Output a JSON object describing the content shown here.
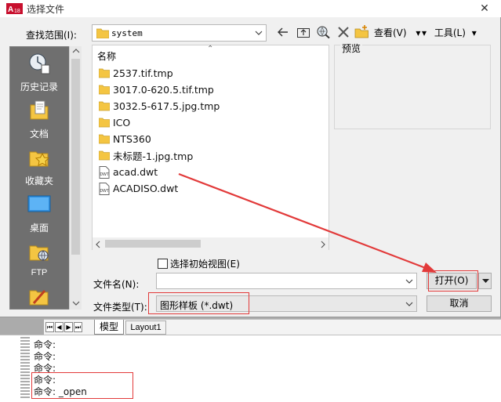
{
  "dialog": {
    "title": "选择文件",
    "look_in_label": "查找范围(I):",
    "look_in_value": "system",
    "views_label": "查看(V)",
    "tools_label": "工具(L)",
    "preview_label": "预览"
  },
  "places": [
    {
      "label": "历史记录",
      "icon": "history-icon"
    },
    {
      "label": "文档",
      "icon": "documents-icon"
    },
    {
      "label": "收藏夹",
      "icon": "favorites-icon"
    },
    {
      "label": "桌面",
      "icon": "desktop-icon"
    },
    {
      "label": "FTP",
      "icon": "ftp-icon"
    },
    {
      "label": "",
      "icon": "buzzsaw-icon"
    }
  ],
  "file_list": {
    "column_name": "名称",
    "items": [
      {
        "name": "2537.tif.tmp",
        "type": "folder"
      },
      {
        "name": "3017.0-620.5.tif.tmp",
        "type": "folder"
      },
      {
        "name": "3032.5-617.5.jpg.tmp",
        "type": "folder"
      },
      {
        "name": "ICO",
        "type": "folder"
      },
      {
        "name": "NTS360",
        "type": "folder"
      },
      {
        "name": "未标题-1.jpg.tmp",
        "type": "folder"
      },
      {
        "name": "acad.dwt",
        "type": "dwt"
      },
      {
        "name": "ACADISO.dwt",
        "type": "dwt"
      }
    ]
  },
  "options": {
    "select_initial_view_label": "选择初始视图(E)"
  },
  "filename": {
    "label": "文件名(N):",
    "value": ""
  },
  "filetype": {
    "label": "文件类型(T):",
    "value": "图形样板 (*.dwt)"
  },
  "buttons": {
    "open": "打开(O)",
    "cancel": "取消"
  },
  "tabs": {
    "model": "模型",
    "layout1": "Layout1"
  },
  "command_lines": [
    "命令:",
    "命令:",
    "命令:",
    "命令:",
    "命令: _open"
  ],
  "colors": {
    "annotation_red": "#e23a3a",
    "folder_yellow": "#f4c542"
  }
}
